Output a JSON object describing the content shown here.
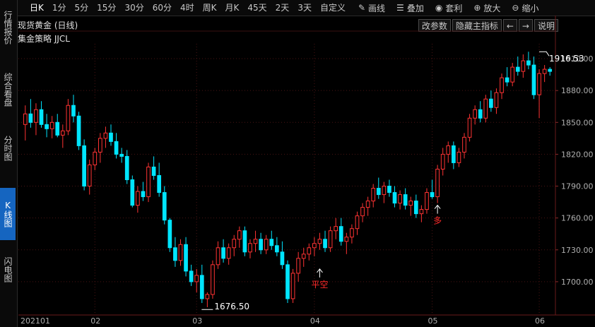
{
  "toolbar": {
    "periods": [
      "日K",
      "1分",
      "5分",
      "15分",
      "30分",
      "60分",
      "4时",
      "周K",
      "月K",
      "45天",
      "2天",
      "3天",
      "自定义"
    ],
    "active_period": "日K",
    "tools": [
      {
        "label": "画线",
        "icon": "pencil-icon"
      },
      {
        "label": "叠加",
        "icon": "layers-icon"
      },
      {
        "label": "套利",
        "icon": "moneybag-icon"
      },
      {
        "label": "放大",
        "icon": "zoom-in-icon"
      },
      {
        "label": "缩小",
        "icon": "zoom-out-icon"
      }
    ]
  },
  "sidebar": {
    "tabs": [
      "行情报价",
      "综合看盘",
      "分时图",
      "K线图",
      "闪电图"
    ],
    "active": "K线图"
  },
  "chart_header": {
    "title": "现货黄金 (日线)",
    "indicator": "集金策略 JJCL",
    "buttons": [
      "改参数",
      "隐藏主指标",
      "←",
      "→",
      "说明"
    ]
  },
  "colors": {
    "up": "#ff3333",
    "down": "#00e5ff",
    "grid": "#4a1414",
    "axis": "#b0b0b0"
  },
  "chart_data": {
    "type": "candlestick",
    "yticks": [
      1910,
      1880,
      1850,
      1820,
      1790,
      1760,
      1730,
      1700
    ],
    "ylim": [
      1672,
      1924
    ],
    "xlabels": [
      {
        "label": "202101",
        "index": 0
      },
      {
        "label": "02",
        "index": 13
      },
      {
        "label": "03",
        "index": 32
      },
      {
        "label": "04",
        "index": 54
      },
      {
        "label": "05",
        "index": 76
      },
      {
        "label": "06",
        "index": 96
      }
    ],
    "high_label": {
      "value": 1916.53,
      "index": 96,
      "text": "1916.53"
    },
    "low_label": {
      "value": 1676.5,
      "index": 34,
      "text": "1676.50"
    },
    "signals": [
      {
        "index": 55,
        "text": "平空",
        "price": 1712
      },
      {
        "index": 77,
        "text": "多",
        "price": 1772
      }
    ],
    "candles": [
      [
        1848,
        1866,
        1833,
        1858
      ],
      [
        1858,
        1872,
        1845,
        1850
      ],
      [
        1850,
        1868,
        1838,
        1862
      ],
      [
        1862,
        1870,
        1845,
        1848
      ],
      [
        1848,
        1858,
        1836,
        1844
      ],
      [
        1844,
        1856,
        1835,
        1850
      ],
      [
        1850,
        1858,
        1836,
        1838
      ],
      [
        1838,
        1848,
        1826,
        1842
      ],
      [
        1842,
        1872,
        1838,
        1866
      ],
      [
        1866,
        1876,
        1850,
        1856
      ],
      [
        1856,
        1860,
        1824,
        1828
      ],
      [
        1828,
        1834,
        1786,
        1790
      ],
      [
        1790,
        1815,
        1782,
        1810
      ],
      [
        1810,
        1826,
        1805,
        1822
      ],
      [
        1822,
        1840,
        1812,
        1835
      ],
      [
        1835,
        1846,
        1826,
        1840
      ],
      [
        1840,
        1848,
        1828,
        1832
      ],
      [
        1832,
        1840,
        1816,
        1820
      ],
      [
        1820,
        1826,
        1812,
        1818
      ],
      [
        1818,
        1824,
        1792,
        1796
      ],
      [
        1796,
        1800,
        1770,
        1772
      ],
      [
        1772,
        1790,
        1765,
        1785
      ],
      [
        1785,
        1794,
        1776,
        1780
      ],
      [
        1780,
        1812,
        1775,
        1808
      ],
      [
        1808,
        1818,
        1796,
        1800
      ],
      [
        1800,
        1812,
        1780,
        1784
      ],
      [
        1784,
        1790,
        1754,
        1758
      ],
      [
        1758,
        1760,
        1728,
        1732
      ],
      [
        1732,
        1742,
        1714,
        1720
      ],
      [
        1720,
        1740,
        1715,
        1735
      ],
      [
        1735,
        1742,
        1705,
        1710
      ],
      [
        1710,
        1716,
        1696,
        1700
      ],
      [
        1700,
        1712,
        1690,
        1706
      ],
      [
        1706,
        1716,
        1680,
        1684
      ],
      [
        1684,
        1690,
        1676,
        1688
      ],
      [
        1688,
        1720,
        1684,
        1716
      ],
      [
        1716,
        1738,
        1712,
        1732
      ],
      [
        1732,
        1740,
        1718,
        1722
      ],
      [
        1722,
        1736,
        1716,
        1732
      ],
      [
        1732,
        1744,
        1724,
        1740
      ],
      [
        1740,
        1752,
        1732,
        1748
      ],
      [
        1748,
        1752,
        1724,
        1728
      ],
      [
        1728,
        1740,
        1722,
        1736
      ],
      [
        1736,
        1748,
        1728,
        1740
      ],
      [
        1740,
        1746,
        1726,
        1730
      ],
      [
        1730,
        1744,
        1726,
        1740
      ],
      [
        1740,
        1748,
        1730,
        1734
      ],
      [
        1734,
        1742,
        1724,
        1728
      ],
      [
        1728,
        1738,
        1712,
        1716
      ],
      [
        1716,
        1720,
        1680,
        1684
      ],
      [
        1684,
        1712,
        1680,
        1708
      ],
      [
        1708,
        1728,
        1700,
        1722
      ],
      [
        1722,
        1732,
        1714,
        1726
      ],
      [
        1726,
        1736,
        1720,
        1732
      ],
      [
        1732,
        1742,
        1724,
        1736
      ],
      [
        1736,
        1746,
        1730,
        1740
      ],
      [
        1740,
        1748,
        1728,
        1732
      ],
      [
        1732,
        1752,
        1728,
        1748
      ],
      [
        1748,
        1760,
        1740,
        1752
      ],
      [
        1752,
        1760,
        1734,
        1738
      ],
      [
        1738,
        1746,
        1726,
        1742
      ],
      [
        1742,
        1754,
        1736,
        1750
      ],
      [
        1750,
        1766,
        1744,
        1762
      ],
      [
        1762,
        1774,
        1756,
        1770
      ],
      [
        1770,
        1780,
        1762,
        1776
      ],
      [
        1776,
        1792,
        1770,
        1788
      ],
      [
        1788,
        1798,
        1778,
        1782
      ],
      [
        1782,
        1794,
        1774,
        1790
      ],
      [
        1790,
        1796,
        1780,
        1784
      ],
      [
        1784,
        1790,
        1770,
        1774
      ],
      [
        1774,
        1786,
        1768,
        1782
      ],
      [
        1782,
        1788,
        1768,
        1772
      ],
      [
        1772,
        1780,
        1762,
        1776
      ],
      [
        1776,
        1782,
        1760,
        1764
      ],
      [
        1764,
        1772,
        1756,
        1768
      ],
      [
        1768,
        1788,
        1764,
        1784
      ],
      [
        1784,
        1796,
        1778,
        1780
      ],
      [
        1780,
        1810,
        1774,
        1806
      ],
      [
        1806,
        1826,
        1800,
        1820
      ],
      [
        1820,
        1832,
        1812,
        1828
      ],
      [
        1828,
        1832,
        1806,
        1812
      ],
      [
        1812,
        1826,
        1808,
        1822
      ],
      [
        1822,
        1840,
        1816,
        1836
      ],
      [
        1836,
        1858,
        1832,
        1854
      ],
      [
        1854,
        1866,
        1848,
        1862
      ],
      [
        1862,
        1870,
        1850,
        1854
      ],
      [
        1854,
        1876,
        1850,
        1872
      ],
      [
        1872,
        1880,
        1860,
        1864
      ],
      [
        1864,
        1882,
        1858,
        1878
      ],
      [
        1878,
        1896,
        1872,
        1892
      ],
      [
        1892,
        1902,
        1884,
        1888
      ],
      [
        1888,
        1906,
        1884,
        1902
      ],
      [
        1902,
        1912,
        1894,
        1898
      ],
      [
        1898,
        1914,
        1892,
        1908
      ],
      [
        1908,
        1916.53,
        1900,
        1904
      ],
      [
        1904,
        1912,
        1872,
        1876
      ],
      [
        1876,
        1900,
        1854,
        1896
      ],
      [
        1896,
        1904,
        1888,
        1900
      ],
      [
        1900,
        1902,
        1894,
        1898
      ]
    ]
  }
}
